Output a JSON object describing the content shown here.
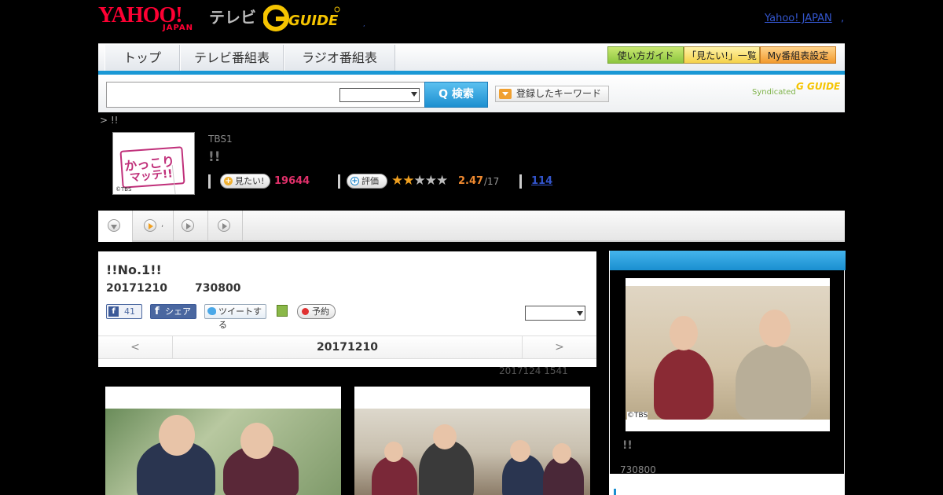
{
  "header": {
    "yahoo_logo": "YAHOO!",
    "japan": "JAPAN",
    "tv": "テレビ",
    "gguide_logo": "G-GUIDE",
    "yahoo_link": "Yahoo! JAPAN",
    "link_sep": ",",
    "dot": ","
  },
  "nav": {
    "tabs": [
      "トップ",
      "テレビ番組表",
      "ラジオ番組表"
    ],
    "guide": "使い方ガイド",
    "want_list": "「見たい!」一覧",
    "my_settings": "My番組表設定"
  },
  "search": {
    "button": "Q 検索",
    "keyword_button": "登録したキーワード",
    "syndicated": "Syndicated",
    "gguide": "G GUIDE"
  },
  "breadcrumb": "> !!",
  "program": {
    "logo_text1": "かっこり",
    "logo_text2": "マッテ!!",
    "copyright": "©TBS",
    "channel": "TBS1",
    "title": "!!",
    "want_label": "見たい!",
    "want_count": "19644",
    "rate_label": "評価",
    "stars_on": "★★",
    "stars_off": "★★★",
    "rating": "2.47",
    "rating_of": "/17",
    "reviews": "114"
  },
  "subtabs": {
    "label": ","
  },
  "episode": {
    "title": "!!No.1!!",
    "date": "20171210",
    "time": "730800",
    "like_count": "41",
    "share": "シェア",
    "tweet": "ツイートする",
    "reserve": "予約",
    "pager_prev": "<",
    "pager_date": "20171210",
    "pager_next": ">",
    "updated": "2017124  1541"
  },
  "sidebar": {
    "copyright": "©TBS",
    "title": "!!",
    "time": "730800"
  }
}
